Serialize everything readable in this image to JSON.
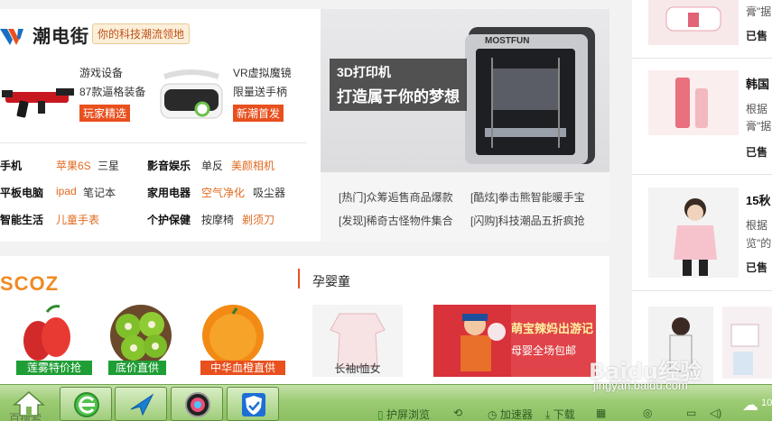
{
  "brand": {
    "logo_text": "潮电街",
    "slogan": "你的科技潮流领地"
  },
  "promos": [
    {
      "title": "游戏设备",
      "sub": "87款逼格装备",
      "tag": "玩家精选"
    },
    {
      "title": "VR虚拟魔镜",
      "sub": "限量送手柄",
      "tag": "新潮首发"
    }
  ],
  "categories": [
    {
      "a": "手机",
      "b": "苹果6S",
      "c": "三星",
      "d": "影音娱乐",
      "e": "单反",
      "f": "美颜相机"
    },
    {
      "a": "平板电脑",
      "b": "ipad",
      "c": "笔记本",
      "d": "家用电器",
      "e": "空气净化",
      "f": "吸尘器"
    },
    {
      "a": "智能生活",
      "b": "儿童手表",
      "c": "",
      "d": "个护保健",
      "e": "按摩椅",
      "f": "剃须刀"
    }
  ],
  "banner": {
    "line1": "3D打印机",
    "line2": "打造属于你的梦想",
    "brand_on_device": "MOSTFUN"
  },
  "news": [
    "[热门]众筹逅售商品爆款",
    "[酷炫]拳击熊智能暖手宝",
    "[发现]稀奇古怪物件集合",
    "[闪购]科技潮品五折疯抢"
  ],
  "section2": {
    "logo": "SCOZ",
    "baby_title": "孕婴童"
  },
  "fruits": [
    {
      "label": "莲雾特价抢",
      "color": "#1f9e35"
    },
    {
      "label": "底价直供",
      "color": "#1f9e35"
    },
    {
      "label": "中华血橙直供",
      "color": "#e8501e"
    }
  ],
  "baby": {
    "dress_label": "长袖t恤女",
    "banner_line1": "萌宝辣妈出游记",
    "banner_line2": "母婴全场包邮"
  },
  "right": [
    {
      "title": "",
      "text": "膏\"据",
      "sold": "已售"
    },
    {
      "title": "韩国",
      "text": "根据",
      "text2": "膏\"据",
      "sold": "已售"
    },
    {
      "title": "15秋",
      "text": "根据",
      "text2": "览\"的",
      "sold": "已售"
    }
  ],
  "taskbar": {
    "items": [
      "护屏浏览",
      "加速器",
      "下载"
    ],
    "ghost": "百搜索",
    "badge": "10"
  },
  "watermark": {
    "text": "Baidu经验",
    "url": "jingyan.baidu.com"
  }
}
